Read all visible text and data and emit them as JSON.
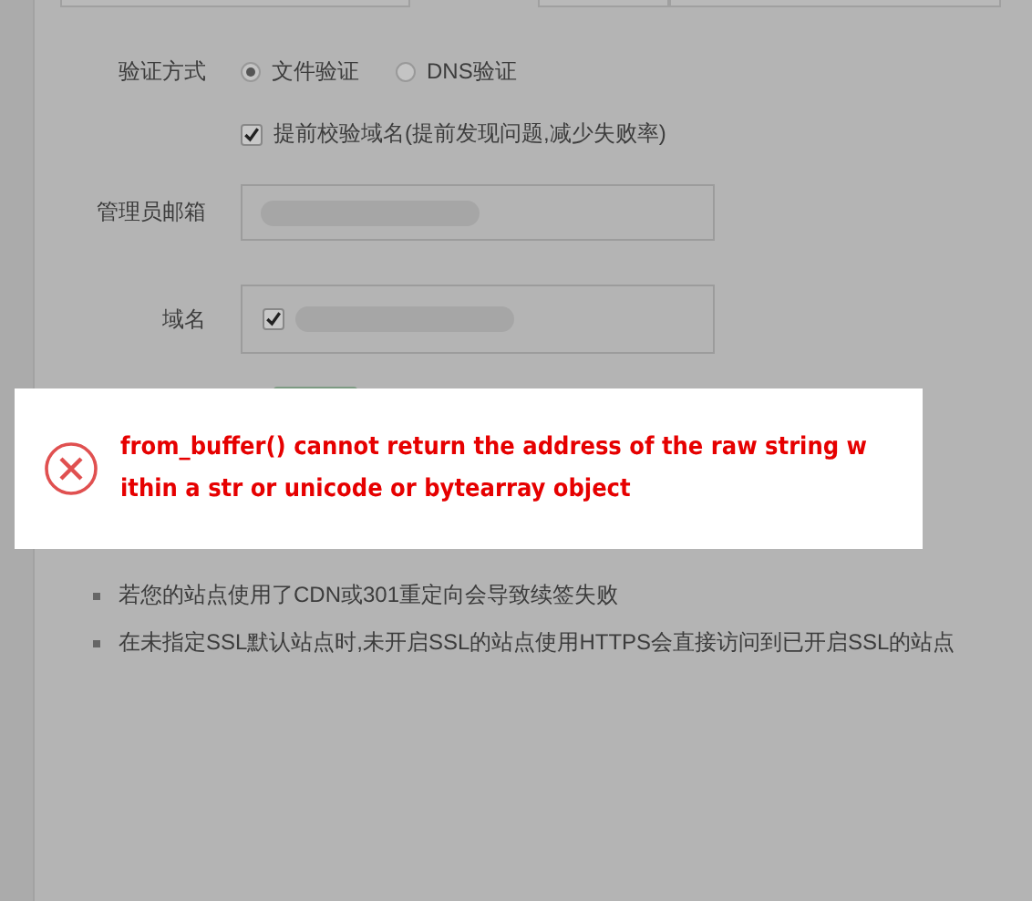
{
  "form": {
    "verify_method": {
      "label": "验证方式",
      "options": [
        {
          "label": "文件验证",
          "selected": true
        },
        {
          "label": "DNS验证",
          "selected": false
        }
      ]
    },
    "precheck": {
      "label": "提前校验域名(提前发现问题,减少失败率)",
      "checked": true
    },
    "admin_email": {
      "label": "管理员邮箱"
    },
    "domain": {
      "label": "域名",
      "checked": true
    }
  },
  "notes": [
    "若您的站点使用了CDN或301重定向会导致续签失败",
    "在未指定SSL默认站点时,未开启SSL的站点使用HTTPS会直接访问到已开启SSL的站点"
  ],
  "toast": {
    "kind": "error",
    "message": "from_buffer() cannot return the address of the raw string w\nithin a str or unicode or bytearray object"
  }
}
